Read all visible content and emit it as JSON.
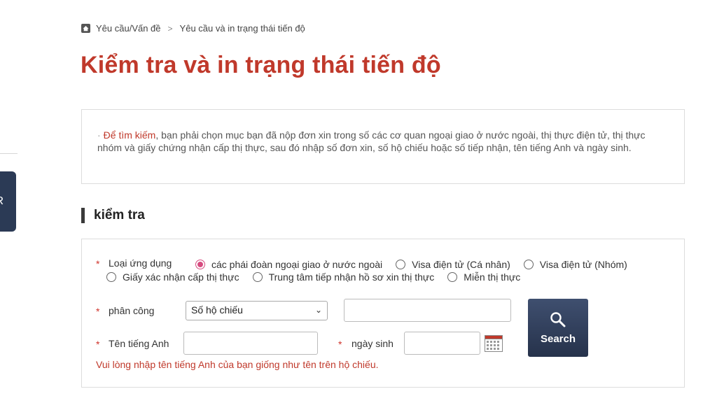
{
  "breadcrumb": {
    "home_icon": "home-icon",
    "items": [
      "Yêu cầu/Vấn đề",
      "Yêu cầu và in trạng thái tiến độ"
    ],
    "separator": ">"
  },
  "page_title": "Kiểm tra và in trạng thái tiến độ",
  "side_tab": {
    "label": "R"
  },
  "notice": {
    "bullet": "·",
    "lead": "Để tìm kiếm",
    "text": ", bạn phải chọn mục bạn đã nộp đơn xin trong số các cơ quan ngoại giao ở nước ngoài, thị thực điện tử, thị thực nhóm và giấy chứng nhận cấp thị thực, sau đó nhập số đơn xin, số hộ chiếu hoặc số tiếp nhận, tên tiếng Anh và ngày sinh."
  },
  "section": {
    "heading": "kiểm tra"
  },
  "form": {
    "required_mark": "*",
    "app_type": {
      "label": "Loại ứng dụng",
      "options_row1": [
        {
          "label": "các phái đoàn ngoại giao ở nước ngoài",
          "checked": true
        },
        {
          "label": "Visa điện tử (Cá nhân)",
          "checked": false
        },
        {
          "label": "Visa điện tử (Nhóm)",
          "checked": false
        }
      ],
      "options_row2": [
        {
          "label": "Giấy xác nhận cấp thị thực",
          "checked": false
        },
        {
          "label": "Trung tâm tiếp nhận hồ sơ xin thị thực",
          "checked": false
        },
        {
          "label": "Miễn thị thực",
          "checked": false
        }
      ]
    },
    "assignment": {
      "label": "phân công",
      "selected": "Số hộ chiếu",
      "value": ""
    },
    "english_name": {
      "label": "Tên tiếng Anh",
      "value": ""
    },
    "birthdate": {
      "label": "ngày sinh",
      "value": "",
      "icon": "calendar-icon"
    },
    "search_button": {
      "label": "Search",
      "icon": "search-icon"
    },
    "hint": "Vui lòng nhập tên tiếng Anh của bạn giống như tên trên hộ chiếu."
  },
  "colors": {
    "title_red": "#c0392b",
    "button_navy": "#2b3a55",
    "radio_pink": "#d64b7f"
  }
}
